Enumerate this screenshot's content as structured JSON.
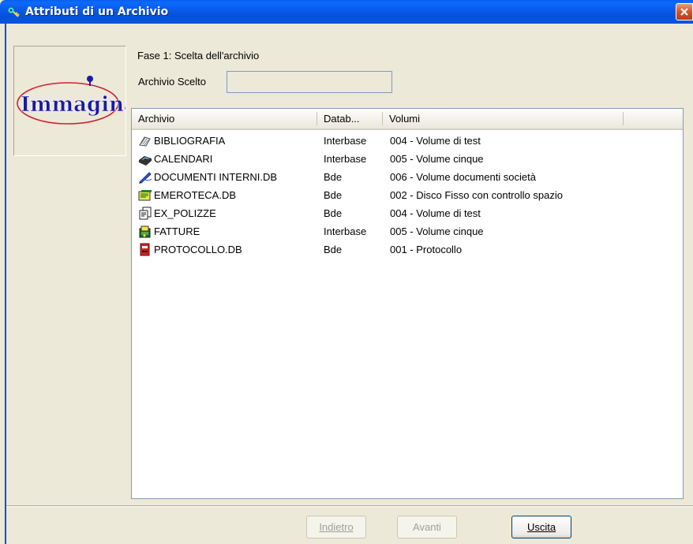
{
  "window": {
    "title": "Attributi di un Archivio",
    "icon": "key-icon",
    "close_icon": "close-icon"
  },
  "logo": {
    "text": "Immagina",
    "color": "#1a1aa8",
    "ring_color": "#d0222a"
  },
  "step": {
    "label": "Fase 1: Scelta dell'archivio"
  },
  "selected": {
    "label": "Archivio Scelto",
    "value": ""
  },
  "list": {
    "columns": [
      "Archivio",
      "Datab...",
      "Volumi"
    ],
    "rows": [
      {
        "icon": "books-icon",
        "name": "BIBLIOGRAFIA",
        "database": "Interbase",
        "volume": "004 - Volume di test"
      },
      {
        "icon": "binder-icon",
        "name": "CALENDARI",
        "database": "Interbase",
        "volume": "005 - Volume cinque"
      },
      {
        "icon": "pen-icon",
        "name": "DOCUMENTI INTERNI.DB",
        "database": "Bde",
        "volume": "006 - Volume documenti società"
      },
      {
        "icon": "newspaper-icon",
        "name": "EMEROTECA.DB",
        "database": "Bde",
        "volume": "002 - Disco Fisso con controllo spazio"
      },
      {
        "icon": "documents-icon",
        "name": "EX_POLIZZE",
        "database": "Bde",
        "volume": "004 - Volume di test"
      },
      {
        "icon": "invoice-icon",
        "name": "FATTURE",
        "database": "Interbase",
        "volume": "005 - Volume cinque"
      },
      {
        "icon": "register-icon",
        "name": "PROTOCOLLO.DB",
        "database": "Bde",
        "volume": "001 - Protocollo"
      }
    ]
  },
  "buttons": {
    "back": {
      "label": "Indietro",
      "enabled": false
    },
    "next": {
      "label": "Avanti",
      "enabled": false
    },
    "exit": {
      "label": "Uscita",
      "enabled": true
    }
  }
}
